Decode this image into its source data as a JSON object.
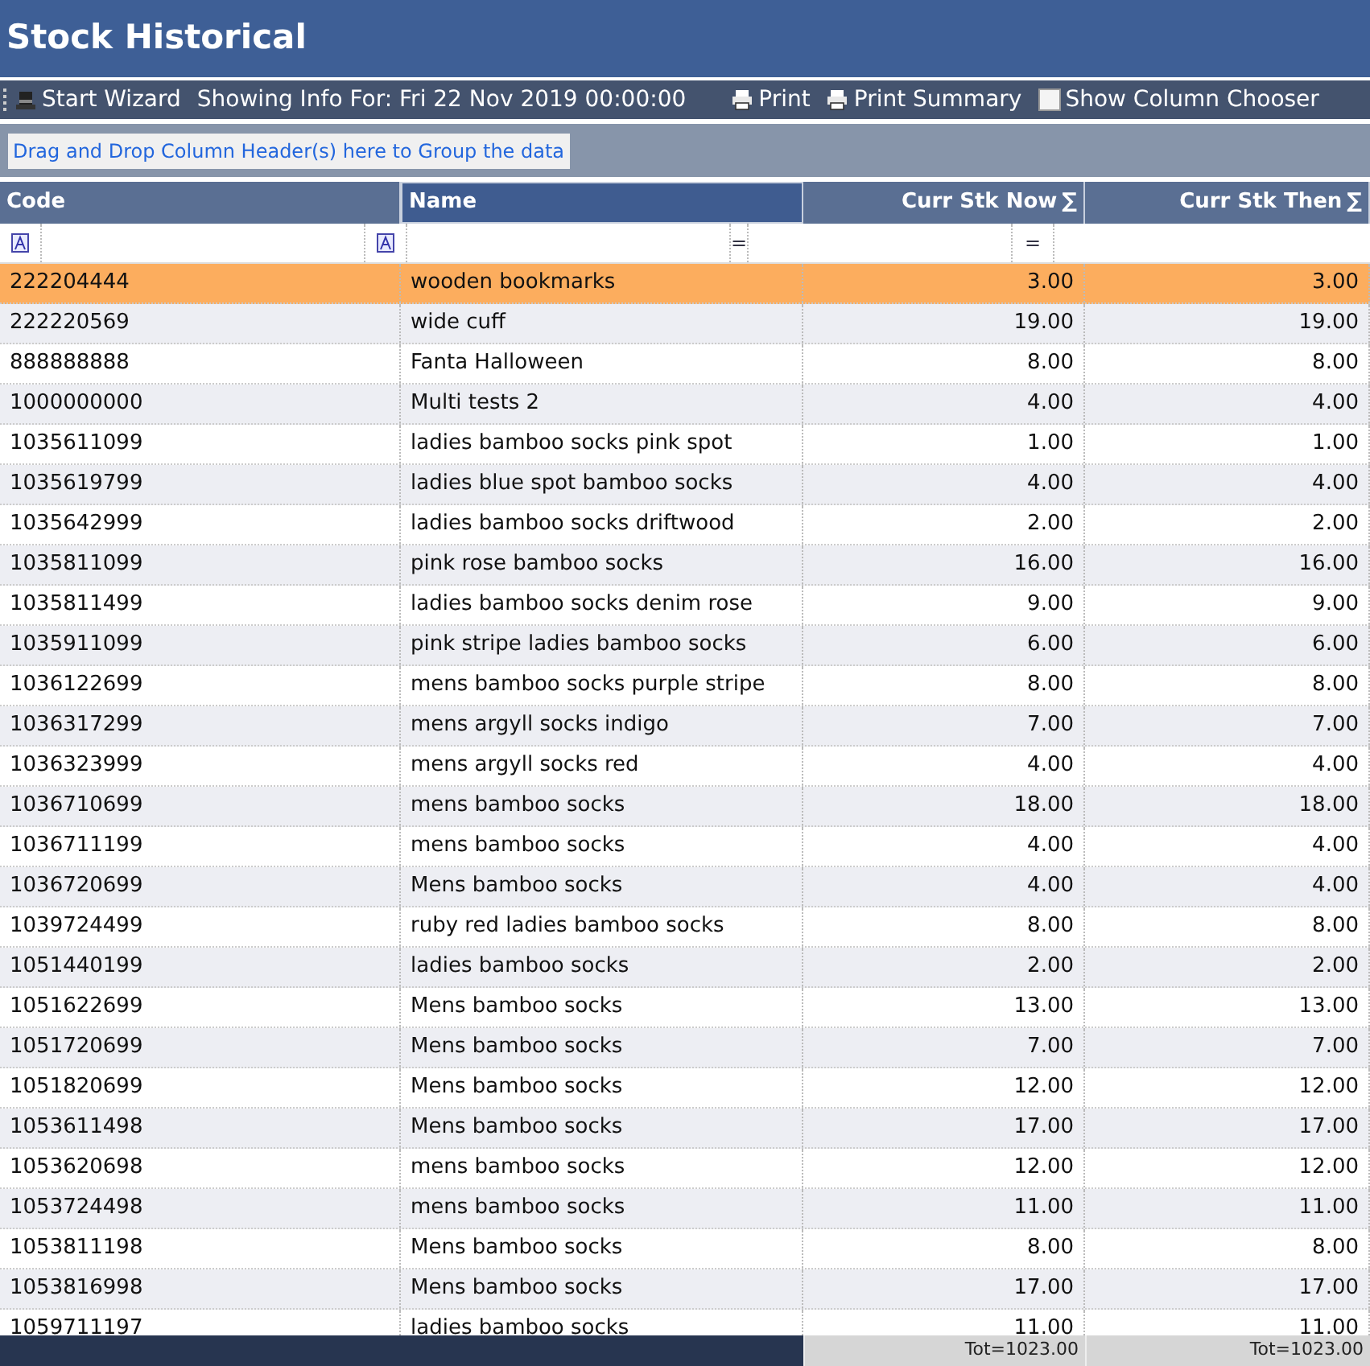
{
  "title": "Stock Historical",
  "toolbar": {
    "wizard": "Start Wizard",
    "info": "Showing Info For: Fri 22 Nov 2019 00:00:00",
    "print": "Print",
    "print_summary": "Print Summary",
    "column_chooser": {
      "label": "Show Column Chooser",
      "checked": false
    }
  },
  "group_hint": "Drag and Drop Column Header(s) here to Group the data",
  "table": {
    "columns": [
      {
        "label": "Code",
        "kind": "text",
        "selected": false
      },
      {
        "label": "Name",
        "kind": "text",
        "selected": true
      },
      {
        "label": "Curr Stk Now",
        "kind": "number",
        "sum_mark": "∑",
        "filter": "=",
        "selected": false
      },
      {
        "label": "Curr Stk Then",
        "kind": "number",
        "sum_mark": "∑",
        "filter": "=",
        "selected": false
      }
    ],
    "rows": [
      {
        "cells": [
          "222204444",
          "wooden bookmarks",
          "3.00",
          "3.00"
        ],
        "selected": true
      },
      {
        "cells": [
          "222220569",
          "wide cuff",
          "19.00",
          "19.00"
        ],
        "selected": false
      },
      {
        "cells": [
          "888888888",
          "Fanta Halloween",
          "8.00",
          "8.00"
        ],
        "selected": false
      },
      {
        "cells": [
          "1000000000",
          "Multi tests 2",
          "4.00",
          "4.00"
        ],
        "selected": false
      },
      {
        "cells": [
          "1035611099",
          "ladies bamboo socks pink spot",
          "1.00",
          "1.00"
        ],
        "selected": false
      },
      {
        "cells": [
          "1035619799",
          "ladies blue spot bamboo socks",
          "4.00",
          "4.00"
        ],
        "selected": false
      },
      {
        "cells": [
          "1035642999",
          "ladies bamboo socks driftwood",
          "2.00",
          "2.00"
        ],
        "selected": false
      },
      {
        "cells": [
          "1035811099",
          "pink rose bamboo socks",
          "16.00",
          "16.00"
        ],
        "selected": false
      },
      {
        "cells": [
          "1035811499",
          "ladies bamboo socks denim rose",
          "9.00",
          "9.00"
        ],
        "selected": false
      },
      {
        "cells": [
          "1035911099",
          "pink stripe ladies bamboo socks",
          "6.00",
          "6.00"
        ],
        "selected": false
      },
      {
        "cells": [
          "1036122699",
          "mens bamboo socks purple stripe",
          "8.00",
          "8.00"
        ],
        "selected": false
      },
      {
        "cells": [
          "1036317299",
          "mens argyll socks indigo",
          "7.00",
          "7.00"
        ],
        "selected": false
      },
      {
        "cells": [
          "1036323999",
          "mens argyll socks red",
          "4.00",
          "4.00"
        ],
        "selected": false
      },
      {
        "cells": [
          "1036710699",
          "mens bamboo socks",
          "18.00",
          "18.00"
        ],
        "selected": false
      },
      {
        "cells": [
          "1036711199",
          "mens bamboo socks",
          "4.00",
          "4.00"
        ],
        "selected": false
      },
      {
        "cells": [
          "1036720699",
          "Mens bamboo socks",
          "4.00",
          "4.00"
        ],
        "selected": false
      },
      {
        "cells": [
          "1039724499",
          "ruby red ladies bamboo socks",
          "8.00",
          "8.00"
        ],
        "selected": false
      },
      {
        "cells": [
          "1051440199",
          "ladies bamboo socks",
          "2.00",
          "2.00"
        ],
        "selected": false
      },
      {
        "cells": [
          "1051622699",
          "Mens bamboo socks",
          "13.00",
          "13.00"
        ],
        "selected": false
      },
      {
        "cells": [
          "1051720699",
          "Mens bamboo socks",
          "7.00",
          "7.00"
        ],
        "selected": false
      },
      {
        "cells": [
          "1051820699",
          "Mens bamboo socks",
          "12.00",
          "12.00"
        ],
        "selected": false
      },
      {
        "cells": [
          "1053611498",
          "Mens bamboo socks",
          "17.00",
          "17.00"
        ],
        "selected": false
      },
      {
        "cells": [
          "1053620698",
          "mens bamboo socks",
          "12.00",
          "12.00"
        ],
        "selected": false
      },
      {
        "cells": [
          "1053724498",
          "mens bamboo socks",
          "11.00",
          "11.00"
        ],
        "selected": false
      },
      {
        "cells": [
          "1053811198",
          "Mens bamboo socks",
          "8.00",
          "8.00"
        ],
        "selected": false
      },
      {
        "cells": [
          "1053816998",
          "Mens bamboo socks",
          "17.00",
          "17.00"
        ],
        "selected": false
      },
      {
        "cells": [
          "1059711197",
          "ladies bamboo socks",
          "11.00",
          "11.00"
        ],
        "selected": false
      }
    ],
    "totals": [
      "Tot=1023.00",
      "Tot=1023.00"
    ]
  }
}
